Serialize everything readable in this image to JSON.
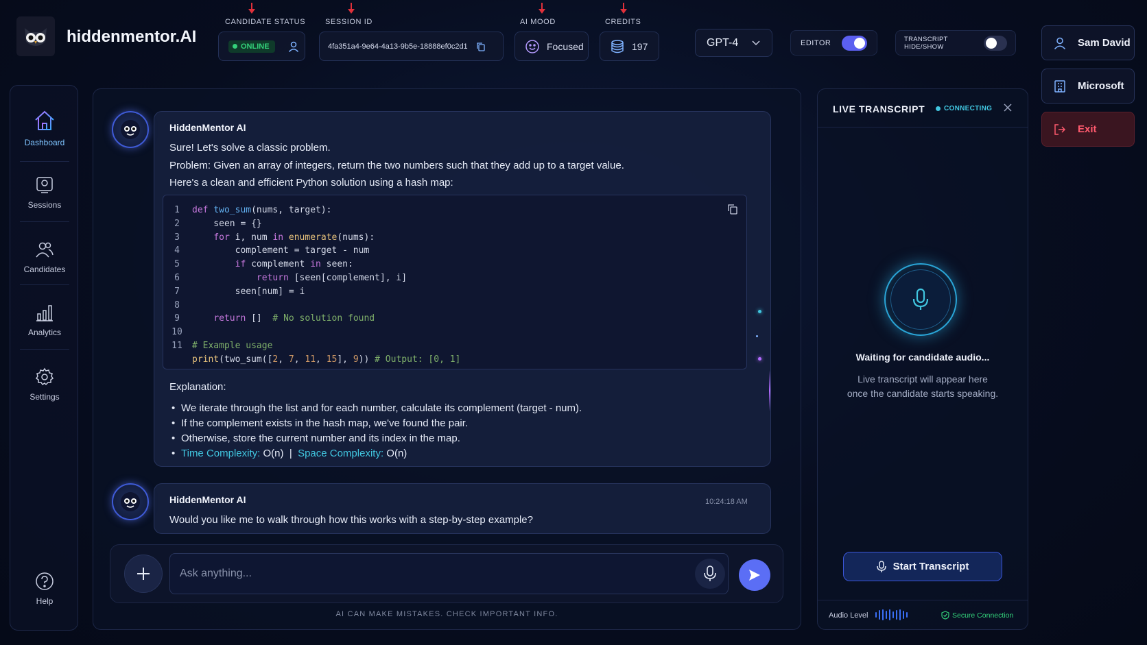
{
  "brand": {
    "name": "hiddenmentor.AI"
  },
  "header": {
    "candidate_status_label": "CANDIDATE STATUS",
    "candidate_status_value": "ONLINE",
    "session_id_label": "SESSION ID",
    "session_id_value": "4fa351a4-9e64-4a13-9b5e-18888ef0c2d1",
    "ai_mood_label": "AI MOOD",
    "ai_mood_value": "Focused",
    "credits_label": "CREDITS",
    "credits_value": "197",
    "model_selected": "GPT-4",
    "editor_label": "EDITOR",
    "editor_on": true,
    "transcript_toggle_label": "TRANSCRIPT HIDE/SHOW",
    "transcript_toggle_on": false
  },
  "user_menu": {
    "user_name": "Sam David",
    "company": "Microsoft",
    "exit_label": "Exit"
  },
  "sidebar": {
    "items": [
      {
        "label": "Dashboard",
        "icon": "home-icon",
        "active": true
      },
      {
        "label": "Sessions",
        "icon": "sessions-icon"
      },
      {
        "label": "Candidates",
        "icon": "users-icon"
      },
      {
        "label": "Analytics",
        "icon": "bar-chart-icon"
      },
      {
        "label": "Settings",
        "icon": "gear-icon"
      }
    ],
    "help_label": "Help"
  },
  "chat": {
    "messages": [
      {
        "sender": "HiddenMentor AI",
        "intro": "Sure! Let's solve a classic problem.",
        "problem": "Problem: Given an array of integers, return the two numbers such that they add up to a target value.",
        "lead": "Here's a clean and efficient Python solution using a hash map:",
        "code_line_numbers": [
          "1",
          "2",
          "3",
          "4",
          "5",
          "6",
          "7",
          "8",
          "9",
          "10",
          "11"
        ],
        "code": {
          "l1_kw": "def",
          "l1_fn": "two_sum",
          "l1_rest": "(nums, target):",
          "l2": "    seen = {}",
          "l3_kw": "for",
          "l3_a": " i, num ",
          "l3_kw2": "in",
          "l3_builtin": "enumerate",
          "l3_rest": "(nums):",
          "l4": "        complement = target - num",
          "l5_kw": "if",
          "l5_a": " complement ",
          "l5_kw2": "in",
          "l5_rest": " seen:",
          "l6_kw": "return",
          "l6_rest": " [seen[complement], i]",
          "l7": "        seen[num] = i",
          "l9_kw": "return",
          "l9_rest": " []  ",
          "l9_cmt": "# No solution found",
          "l11_cmt": "# Example usage",
          "l12_builtin": "print",
          "l12_a": "(two_sum([",
          "l12_n1": "2",
          "l12_c1": ", ",
          "l12_n2": "7",
          "l12_c2": ", ",
          "l12_n3": "11",
          "l12_c3": ", ",
          "l12_n4": "15",
          "l12_c4": "], ",
          "l12_n5": "9",
          "l12_c5": ")) ",
          "l12_cmt": "# Output: [0, 1]"
        },
        "explanation_label": "Explanation:",
        "bullets": [
          "We iterate through the list and for each number, calculate its complement (target - num).",
          "If the complement exists in the hash map, we've found the pair.",
          "Otherwise, store the current number and its index in the map."
        ],
        "complexity": {
          "time_label": "Time Complexity:",
          "time_value": " O(n)",
          "sep": "  |  ",
          "space_label": "Space Complexity:",
          "space_value": " O(n)"
        }
      },
      {
        "sender": "HiddenMentor AI",
        "timestamp": "10:24:18 AM",
        "text": "Would you like me to walk through how this works with a step-by-step example?"
      }
    ],
    "input_placeholder": "Ask anything...",
    "disclaimer": "AI CAN MAKE MISTAKES. CHECK IMPORTANT INFO."
  },
  "transcript": {
    "title": "LIVE TRANSCRIPT",
    "status": "CONNECTING",
    "waiting": "Waiting for candidate audio...",
    "sub_line1": "Live transcript will appear here",
    "sub_line2": "once the candidate starts speaking.",
    "start_label": "Start Transcript",
    "audio_level_label": "Audio Level",
    "secure_label": "Secure Connection"
  },
  "colors": {
    "accent": "#5b6ef5",
    "online": "#33d17a",
    "cyan": "#41c6e0",
    "exit": "#ff5a6e",
    "arrow": "#e0303a"
  }
}
